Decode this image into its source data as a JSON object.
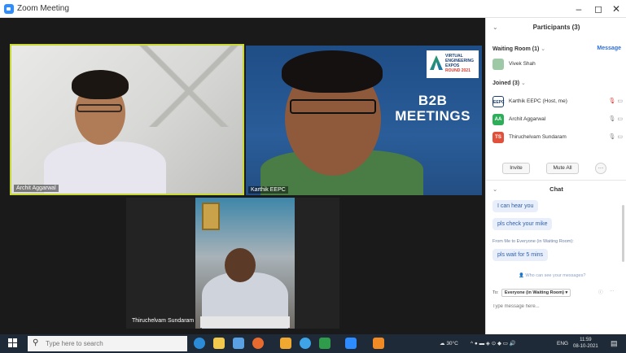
{
  "window": {
    "title": "Zoom Meeting",
    "controls": {
      "minimize": "–",
      "maximize": "◻",
      "close": "✕"
    }
  },
  "videos": {
    "archit_name": "Archit Aggarwal",
    "karthik_name": "Karthik EEPC",
    "thiru_name": "Thiruchelvam Sundaram",
    "banner_line1": "B2B",
    "banner_line2": "MEETINGS",
    "logo_lines": [
      "VIRTUAL",
      "ENGINEERING",
      "EXPOS",
      "ROUND 2021"
    ]
  },
  "participants": {
    "header": "Participants (3)",
    "waiting_room": "Waiting Room (1)",
    "message_link": "Message",
    "waiting": [
      {
        "name": "Vivek Shah",
        "avatar": "",
        "color": "#9ec9a6"
      }
    ],
    "joined_label": "Joined (3)",
    "joined": [
      {
        "name": "Karthik EEPC (Host, me)",
        "avatar": "EEPC",
        "color": "#ffffff"
      },
      {
        "name": "Archit Aggarwal",
        "avatar": "AA",
        "color": "#2fae5a"
      },
      {
        "name": "Thiruchelvam Sundaram",
        "avatar": "TS",
        "color": "#e0503a"
      }
    ],
    "invite_label": "Invite",
    "mute_all_label": "Mute All",
    "more_label": "···"
  },
  "chat": {
    "header": "Chat",
    "messages": [
      "I can hear you",
      "pls check your mike"
    ],
    "from_line": "From Me to Everyone (in Waiting Room):",
    "last_message": "pls wait for 5 mins",
    "who_can_see": "Who can see your messages?",
    "to_label": "To:",
    "to_value": "Everyone (in Waiting Room) ▾",
    "input_placeholder": "Type message here..."
  },
  "taskbar": {
    "search_placeholder": "Type here to search",
    "weather": "30°C",
    "language": "ENG",
    "time": "11:59",
    "date": "08-10-2021"
  }
}
